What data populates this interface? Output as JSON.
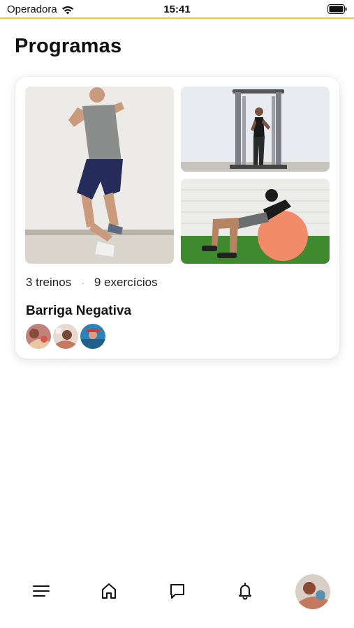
{
  "status_bar": {
    "carrier": "Operadora",
    "time": "15:41",
    "accent_color": "#f2c230"
  },
  "page": {
    "title": "Programas"
  },
  "program_card": {
    "stats_workouts": "3 treinos",
    "stats_separator": "·",
    "stats_exercises": "9 exercícios",
    "name": "Barriga Negativa",
    "photos": [
      "man-jumping-photo",
      "woman-cable-machine-photo",
      "woman-exercise-ball-photo"
    ],
    "avatar_count": 3
  },
  "bottom_nav": {
    "items": [
      "menu-icon",
      "home-icon",
      "chat-icon",
      "bell-icon",
      "profile-avatar"
    ]
  }
}
